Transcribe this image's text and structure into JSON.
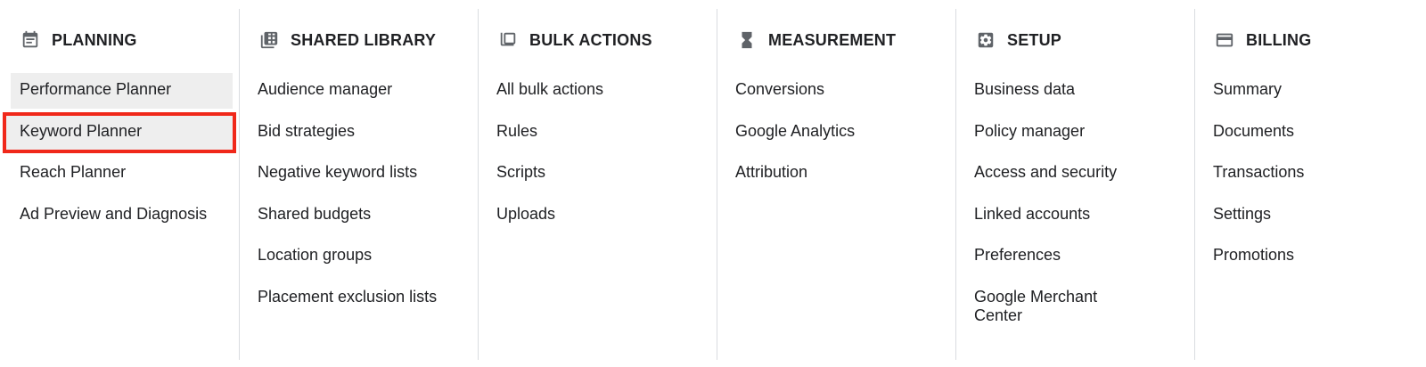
{
  "columns": [
    {
      "title": "PLANNING",
      "icon": "calendar-note-icon",
      "items": [
        {
          "label": "Performance Planner",
          "state": "hover"
        },
        {
          "label": "Keyword Planner",
          "state": "selected"
        },
        {
          "label": "Reach Planner"
        },
        {
          "label": "Ad Preview and Diagnosis"
        }
      ]
    },
    {
      "title": "SHARED LIBRARY",
      "icon": "grid-library-icon",
      "items": [
        {
          "label": "Audience manager"
        },
        {
          "label": "Bid strategies"
        },
        {
          "label": "Negative keyword lists"
        },
        {
          "label": "Shared budgets"
        },
        {
          "label": "Location groups"
        },
        {
          "label": "Placement exclusion lists"
        }
      ]
    },
    {
      "title": "BULK ACTIONS",
      "icon": "copy-stack-icon",
      "items": [
        {
          "label": "All bulk actions"
        },
        {
          "label": "Rules"
        },
        {
          "label": "Scripts"
        },
        {
          "label": "Uploads"
        }
      ]
    },
    {
      "title": "MEASUREMENT",
      "icon": "hourglass-icon",
      "items": [
        {
          "label": "Conversions"
        },
        {
          "label": "Google Analytics"
        },
        {
          "label": "Attribution"
        }
      ]
    },
    {
      "title": "SETUP",
      "icon": "settings-gear-icon",
      "items": [
        {
          "label": "Business data"
        },
        {
          "label": "Policy manager"
        },
        {
          "label": "Access and security"
        },
        {
          "label": "Linked accounts"
        },
        {
          "label": "Preferences"
        },
        {
          "label": "Google Merchant Center"
        }
      ]
    },
    {
      "title": "BILLING",
      "icon": "credit-card-icon",
      "items": [
        {
          "label": "Summary"
        },
        {
          "label": "Documents"
        },
        {
          "label": "Transactions"
        },
        {
          "label": "Settings"
        },
        {
          "label": "Promotions"
        }
      ]
    }
  ],
  "colors": {
    "text": "#202124",
    "icon": "#5f6368",
    "divider": "#dadce0",
    "hover_bg": "#eeeeee",
    "highlight_outline": "#f0281a"
  }
}
